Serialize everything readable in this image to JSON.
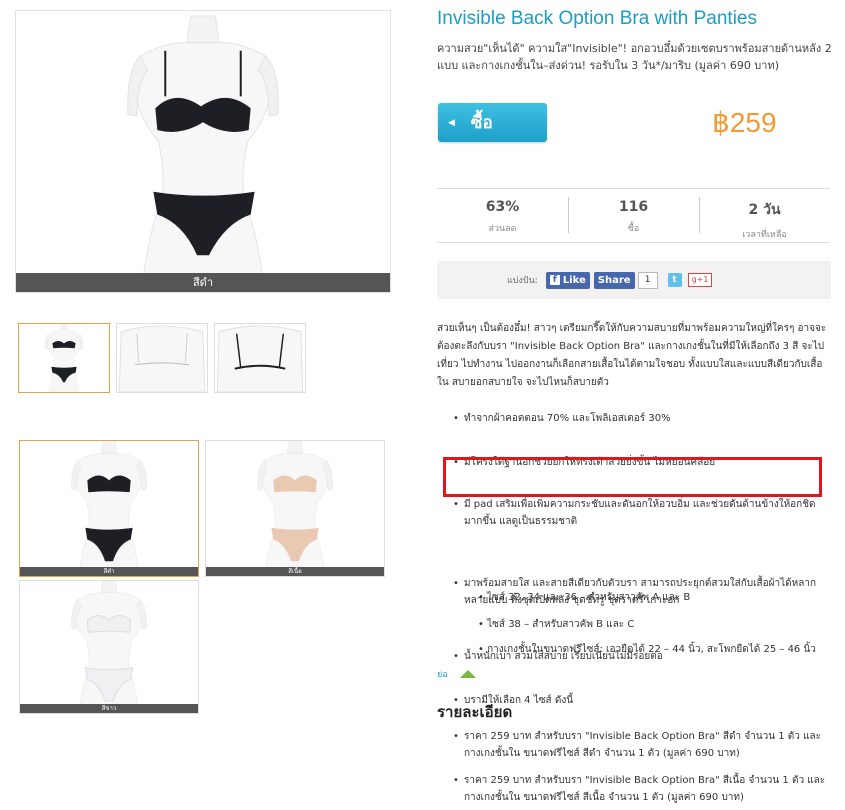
{
  "product": {
    "title": "Invisible Back Option Bra with Panties",
    "subtitle": "ความสวย\"เห็นได้\" ความใส\"Invisible\"! อกอวบอึ๋มด้วยเซตบราพร้อมสายด้านหลัง 2 แบบ และกางเกงชั้นใน–ส่งด่วน! รอรับใน 3 วัน*/มาริบ (มูลค่า 690 บาท)",
    "buy_label": "ซื้อ",
    "price": "฿259",
    "main_photo_caption": "สีดำ"
  },
  "stats": [
    {
      "value": "63%",
      "label": "ส่วนลด"
    },
    {
      "value": "116",
      "label": "ซื้อ"
    },
    {
      "value": "2 วัน",
      "label": "เวลาที่เหลือ"
    }
  ],
  "share": {
    "label": "แบ่งปัน:",
    "like": "Like",
    "share": "Share",
    "count": "1",
    "gplus": "g+1"
  },
  "gallery": {
    "captions": [
      "สีดำ",
      "สีเนื้อ",
      "สีขาว"
    ]
  },
  "description": "สวยเห็นๆ เป็นต้องอึ๋ม! สาวๆ เตรียมกรี๊ดให้กับความสบายที่มาพร้อมความใหญ่ที่ใครๆ อาจจะต้องตะลึงกับบรา \"Invisible Back Option Bra\" และกางเกงชั้นในที่มีให้เลือกถึง 3 สี จะไปเที่ยว ไปทำงาน ไปออกงานก็เลือกสายเสื้อในได้ตามใจชอบ ทั้งแบบใสและแบบสีเดียวกับเสื้อใน สบายอกสบายใจ จะไปไหนก็สบายตัว",
  "features": [
    "ทำจากผ้าคอตตอน 70% และโพลิเอสเตอร์ 30%",
    "มีโครงใต้ฐานอกช่วยยกให้ทรงเต้าสวยยิ่งขึ้น ไม่หย่อนคล้อย",
    "มี pad เสริมเพื่อเพิ่มความกระชับและดันอกให้อวบอิ่ม และช่วยดันด้านข้างให้อกชิดมากขึ้น แลดูเป็นธรรมชาติ",
    "มาพร้อมสายใส และสายสีเดียวกับตัวบรา สามารถประยุกต์สวมใส่กับเสื้อผ้าได้หลากหลายแบบ ทั้งชุดเปิดหลัง ชุดชีทรู ชุดราตรี เกาะอก",
    "น้ำหนักเบา สวมใส่สบาย เรียบเนียนไม่มีรอยต่อ",
    "บรามีให้เลือก 4 ไซส์ ดังนี้"
  ],
  "sizes": [
    "ไซส์ 32, 34 และ 36 – สำหรับสาวคัพ A และ B",
    "ไซส์ 38 – สำหรับสาวคัพ B และ C",
    "กางเกงชั้นในขนาดฟรีไซส์: เอวยืดได้ 22 – 44 นิ้ว, สะโพกยืดได้ 25 – 46 นิ้ว"
  ],
  "collapse_label": "ย่อ",
  "details_title": "รายละเอียด",
  "details": [
    "ราคา 259 บาท สำหรับบรา \"Invisible Back Option Bra\" สีดำ จำนวน 1 ตัว และกางเกงชั้นใน ขนาดฟรีไซส์ สีดำ จำนวน 1 ตัว (มูลค่า 690 บาท)",
    "ราคา 259 บาท สำหรับบรา \"Invisible Back Option Bra\" สีเนื้อ จำนวน 1 ตัว และกางเกงชั้นใน ขนาดฟรีไซส์ สีเนื้อ จำนวน 1 ตัว (มูลค่า 690 บาท)"
  ],
  "colors": {
    "accent": "#1b9ec3",
    "price": "#f39a34",
    "highlight": "#e0161c",
    "lingerie_black": "#1e1f24",
    "lingerie_nude": "#e9c9b1",
    "lingerie_white": "#f4f4f6"
  }
}
